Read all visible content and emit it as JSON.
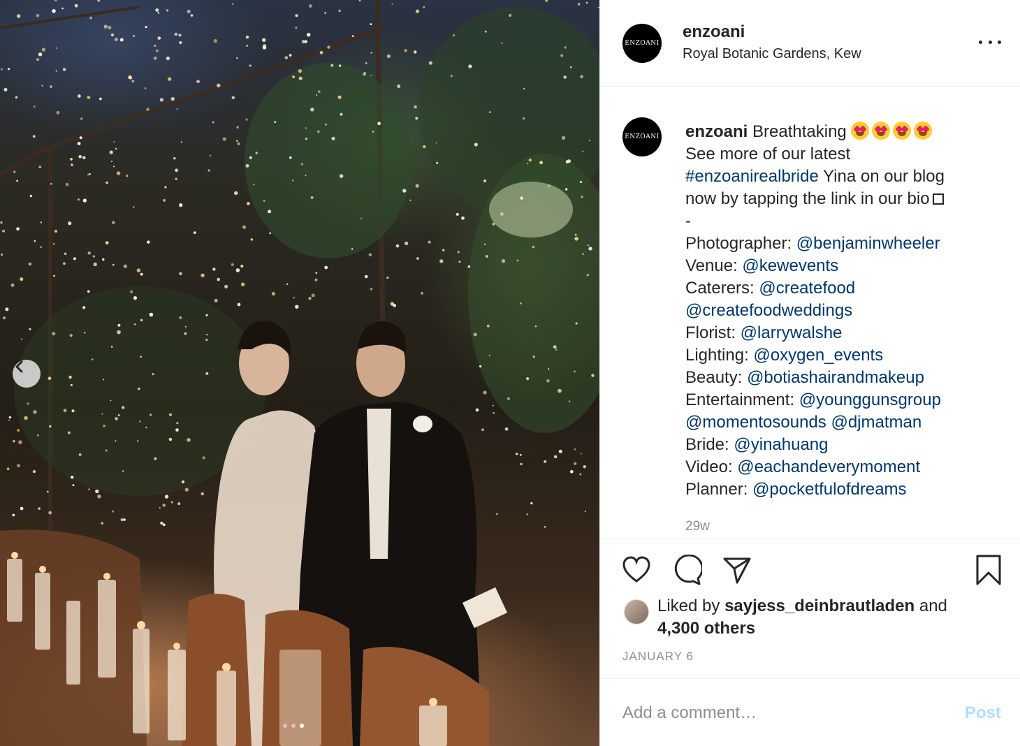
{
  "photo": {
    "description_icons": [
      "chevron-left-icon"
    ],
    "carousel": {
      "count": 3,
      "active_index": 2
    }
  },
  "post": {
    "avatar_text": "ENZOANI",
    "username": "enzoani",
    "location": "Royal Botanic Gardens, Kew",
    "more_icon": "more-options-icon"
  },
  "caption": {
    "username": "enzoani",
    "first_text": "Breathtaking",
    "emoji_count": 4,
    "line2": "See more of our latest",
    "hashtag": "#enzoanirealbride",
    "line3_rest": " Yina on our blog",
    "line4": "now by tapping the link in our bio",
    "line5": "-",
    "credits": [
      {
        "label": "Photographer: ",
        "handles": [
          "@benjaminwheeler"
        ]
      },
      {
        "label": "Venue: ",
        "handles": [
          "@kewevents"
        ]
      },
      {
        "label": "Caterers: ",
        "handles": [
          "@createfood"
        ]
      },
      {
        "label": "",
        "handles": [
          "@createfoodweddings"
        ]
      },
      {
        "label": "Florist: ",
        "handles": [
          "@larrywalshe"
        ]
      },
      {
        "label": "Lighting: ",
        "handles": [
          "@oxygen_events"
        ]
      },
      {
        "label": "Beauty: ",
        "handles": [
          "@botiashairandmakeup"
        ]
      },
      {
        "label": "Entertainment: ",
        "handles": [
          "@younggunsgroup"
        ]
      },
      {
        "label": "",
        "handles": [
          "@momentosounds",
          "@djmatman"
        ]
      },
      {
        "label": "Bride: ",
        "handles": [
          "@yinahuang"
        ]
      },
      {
        "label": "Video: ",
        "handles": [
          "@eachandeverymoment"
        ]
      },
      {
        "label": "Planner: ",
        "handles": [
          "@pocketfulofdreams"
        ]
      }
    ],
    "time_ago": "29w"
  },
  "actions": {
    "icons": [
      "heart-icon",
      "comment-icon",
      "share-icon",
      "bookmark-icon"
    ],
    "liked_by_prefix": "Liked by ",
    "liked_by_user": "sayjess_deinbrautladen",
    "liked_by_and": " and",
    "others": "4,300 others",
    "date": "JANUARY 6"
  },
  "comment": {
    "placeholder": "Add a comment…",
    "post_label": "Post",
    "post_color": "#b2dffc"
  },
  "colors": {
    "link": "#00376b",
    "muted": "#8e8e8e",
    "text": "#262626",
    "border": "#efefef"
  }
}
